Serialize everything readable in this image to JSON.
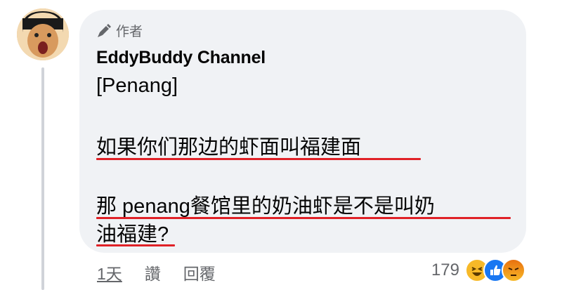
{
  "comment": {
    "author_badge": "作者",
    "author_name": "EddyBuddy Channel",
    "lines": [
      "[Penang]",
      "如果你们那边的虾面叫福建面",
      "那 penang餐馆里的奶油虾是不是叫奶",
      "油福建?"
    ]
  },
  "actions": {
    "time": "1天",
    "like": "讚",
    "reply": "回覆"
  },
  "reactions": {
    "count": "179",
    "icons": [
      "laugh-icon",
      "like-icon",
      "angry-icon"
    ]
  },
  "colors": {
    "bubble": "#f0f2f5",
    "underline": "#e02127",
    "secondary_text": "#65676b"
  }
}
